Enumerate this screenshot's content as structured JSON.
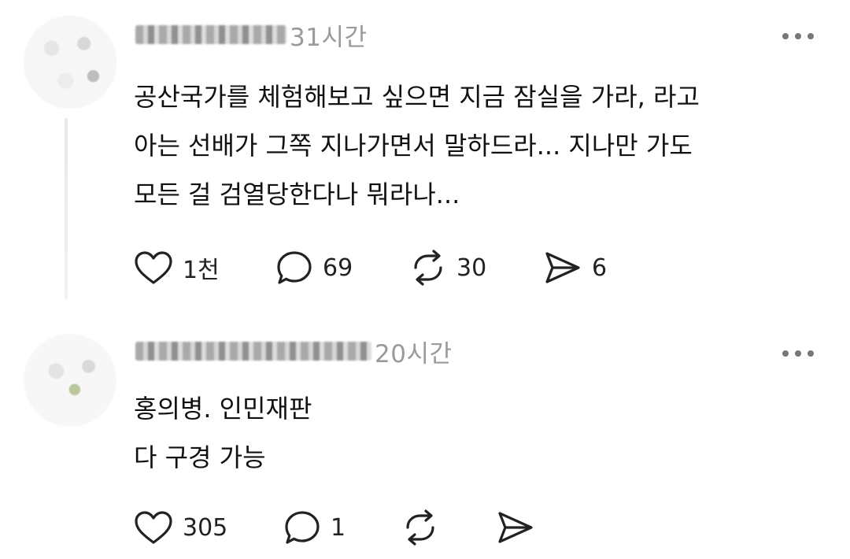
{
  "posts": [
    {
      "time": "31시간",
      "text": "공산국가를 체험해보고 싶으면 지금 잠실을 가라, 라고\n아는 선배가 그쪽 지나가면서 말하드라... 지나만 가도\n모든 걸 검열당한다나 뭐라나...",
      "likes": "1천",
      "replies": "69",
      "reposts": "30",
      "shares": "6"
    },
    {
      "time": "20시간",
      "text": "홍의병. 인민재판\n다 구경 가능",
      "likes": "305",
      "replies": "1",
      "reposts": "",
      "shares": ""
    }
  ],
  "icons": [
    "heart-icon",
    "comment-icon",
    "repost-icon",
    "send-icon",
    "more-icon"
  ],
  "colors": {
    "text": "#111111",
    "muted": "#9a9a9a",
    "icon": "#222222"
  }
}
